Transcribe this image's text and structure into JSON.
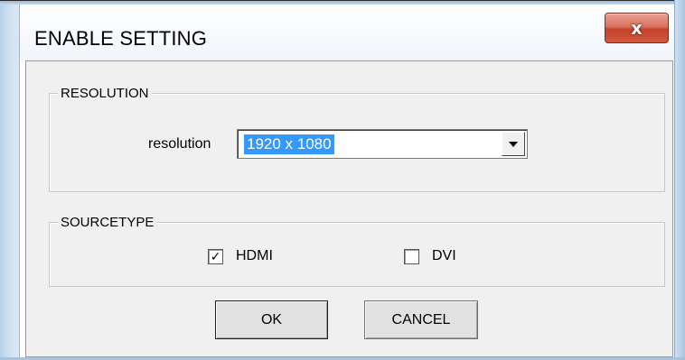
{
  "window": {
    "title": "ENABLE SETTING",
    "close_label": "x"
  },
  "resolution_group": {
    "title": "RESOLUTION",
    "label": "resolution",
    "selected_value": "1920 x 1080"
  },
  "sourcetype_group": {
    "title": "SOURCETYPE",
    "options": [
      {
        "label": "HDMI",
        "checked": true
      },
      {
        "label": "DVI",
        "checked": false
      }
    ]
  },
  "buttons": {
    "ok_label": "OK",
    "cancel_label": "CANCEL"
  },
  "colors": {
    "selection": "#3399ff",
    "dialog_bg": "#f0f0f0",
    "close_button": "#c4422c"
  },
  "icons": {
    "close": "close-icon",
    "dropdown": "chevron-down-icon",
    "check": "checkmark-icon"
  }
}
